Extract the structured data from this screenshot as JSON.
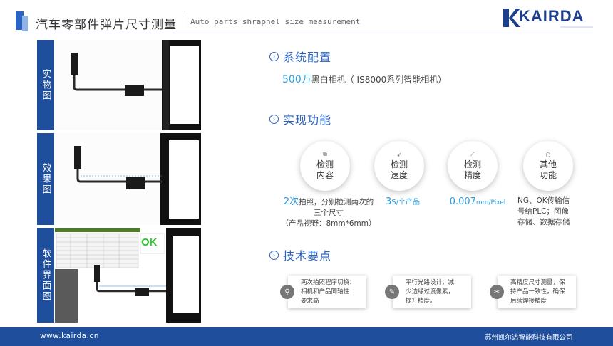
{
  "header": {
    "title_cn": "汽车零部件弹片尺寸测量",
    "title_en": "Auto parts shrapnel size measurement",
    "logo": "KAIRDA"
  },
  "left": {
    "labels": [
      "实物图",
      "效果图",
      "软件界面图"
    ],
    "ok_text": "OK"
  },
  "sections": {
    "config_title": "系统配置",
    "config_big": "500万",
    "config_rest": "黑白相机（ IS8000系列智能相机）",
    "function_title": "实现功能",
    "tech_title": "技术要点"
  },
  "functions": [
    {
      "l1": "检测",
      "l2": "内容",
      "icon": "copy-icon",
      "glyph": "⧉"
    },
    {
      "l1": "检测",
      "l2": "速度",
      "icon": "rocket-icon",
      "glyph": "➶"
    },
    {
      "l1": "检测",
      "l2": "精度",
      "icon": "ruler-icon",
      "glyph": "⟋"
    },
    {
      "l1": "其他",
      "l2": "功能",
      "icon": "cube-icon",
      "glyph": "⬡"
    }
  ],
  "function_desc": {
    "d1_big": "2次",
    "d1_a": "拍照，分别检测两次的",
    "d1_b": "三个尺寸",
    "d1_c": "（产品视野：8mm*6mm）",
    "d2_big": "3",
    "d2_rest": "S/个产品",
    "d3_big": "0.007",
    "d3_rest": "mm/Pixel",
    "d4_a": "NG、OK传输信",
    "d4_b": "号给PLC；图像",
    "d4_c": "存储、数据存储"
  },
  "tech": [
    {
      "icon": "search-icon",
      "glyph": "⚲",
      "l1": "两次拍照程序切换：",
      "l2": "相机和产品同轴性",
      "l3": "要求高"
    },
    {
      "icon": "edit-icon",
      "glyph": "✎",
      "l1": "平行光路设计，减",
      "l2": "少边缘过渡像素，",
      "l3": "提升精度。"
    },
    {
      "icon": "wrench-icon",
      "glyph": "✂",
      "l1": "高精度尺寸测量，保",
      "l2": "持产品一致性，确保",
      "l3": "后续焊接精度"
    }
  ],
  "footer": {
    "website": "www.kairda.cn",
    "company": "苏州凯尔达智能科技有限公司"
  },
  "colors": {
    "accent": "#2a63c4",
    "label_bg": "#1f4f9c",
    "highlight": "#2a9fe0",
    "ok": "#2ec62e"
  }
}
